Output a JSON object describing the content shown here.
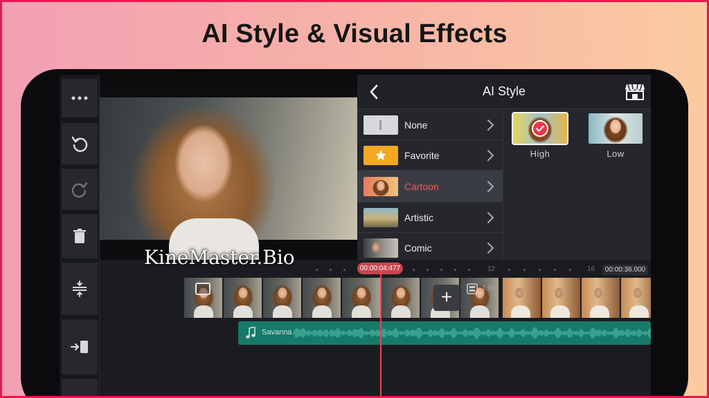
{
  "banner": {
    "headline": "AI Style & Visual Effects"
  },
  "watermark": "KineMaster.Bio",
  "toolbar": {
    "items": [
      {
        "icon": "more-icon"
      },
      {
        "icon": "undo-icon"
      },
      {
        "icon": "redo-icon"
      },
      {
        "icon": "delete-icon"
      },
      {
        "icon": "split-adjust-icon"
      },
      {
        "icon": "export-icon"
      }
    ]
  },
  "panel": {
    "title": "AI Style",
    "styles": [
      {
        "label": "None",
        "thumb": "none"
      },
      {
        "label": "Favorite",
        "thumb": "star"
      },
      {
        "label": "Cartoon",
        "thumb": "face",
        "active": true
      },
      {
        "label": "Artistic",
        "thumb": "scene"
      },
      {
        "label": "Comic",
        "thumb": "face"
      }
    ],
    "levels": [
      {
        "label": "High",
        "selected": true
      },
      {
        "label": "Low",
        "selected": false
      }
    ]
  },
  "timeline": {
    "current_time": "00:00:04:477",
    "total_time": "00:00:36.000",
    "ruler_marks": [
      "12",
      "16"
    ],
    "speed": "1.0x",
    "audio_track": "Savanna"
  },
  "colors": {
    "accent": "#e8394d",
    "active_label": "#ee5a5a",
    "audio": "#167a6a",
    "favorite": "#f4a821"
  }
}
